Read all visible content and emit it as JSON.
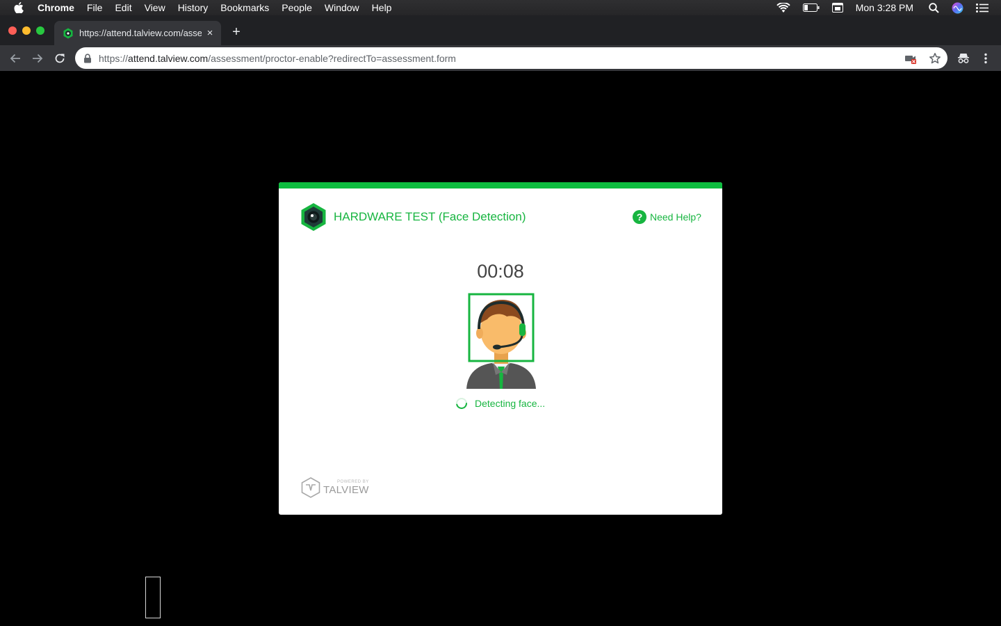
{
  "menubar": {
    "items": [
      "Chrome",
      "File",
      "Edit",
      "View",
      "History",
      "Bookmarks",
      "People",
      "Window",
      "Help"
    ],
    "clock": "Mon 3:28 PM"
  },
  "browser": {
    "tab_title": "https://attend.talview.com/assessment/proctor-enable",
    "tab_close": "×",
    "new_tab": "+",
    "url_scheme": "https://",
    "url_host": "attend.talview.com",
    "url_path": "/assessment/proctor-enable?redirectTo=assessment.form"
  },
  "modal": {
    "title": "HARDWARE TEST (Face Detection)",
    "help_icon_glyph": "?",
    "help_label": "Need Help?",
    "timer": "00:08",
    "status": "Detecting face...",
    "brand_small": "POWERED BY",
    "brand_name": "TALVIEW"
  },
  "colors": {
    "accent": "#0dbd3f",
    "accent_text": "#17b540"
  }
}
